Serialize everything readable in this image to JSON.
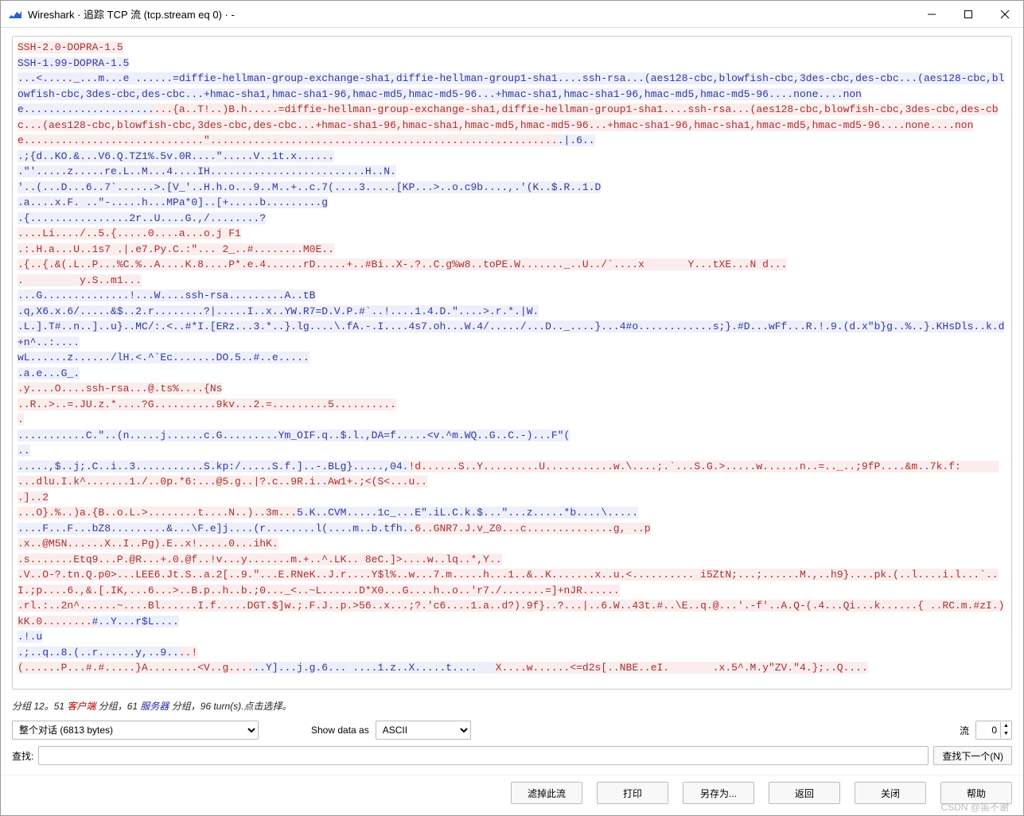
{
  "window": {
    "title": "Wireshark · 追踪 TCP 流 (tcp.stream eq 0) · -"
  },
  "stream": {
    "segments": [
      {
        "d": "c",
        "t": "SSH-2.0-DOPRA-1.5"
      },
      {
        "d": "br"
      },
      {
        "d": "s",
        "t": "SSH-1.99-DOPRA-1.5"
      },
      {
        "d": "br"
      },
      {
        "d": "s",
        "t": "...<....._...m...e ......=diffie-hellman-group-exchange-sha1,diffie-hellman-group1-sha1....ssh-rsa...(aes128-cbc,blowfish-cbc,3des-cbc,des-cbc...(aes128-cbc,blowfish-cbc,3des-cbc,des-cbc...+hmac-sha1,hmac-sha1-96,hmac-md5,hmac-md5-96...+hmac-sha1,hmac-sha1-96,hmac-md5,hmac-md5-96....none....none....................."
      },
      {
        "d": "c",
        "t": "...{a..T!..)B.h.....=diffie-hellman-group-exchange-sha1,diffie-hellman-group1-sha1....ssh-rsa...(aes128-cbc,blowfish-cbc,3des-cbc,des-cbc...(aes128-cbc,blowfish-cbc,3des-cbc,des-cbc...+hmac-sha1-96,hmac-sha1,hmac-md5,hmac-md5-96...+hmac-sha1-96,hmac-sha1,hmac-md5,hmac-md5-96....none....none.............................\"........................................................"
      },
      {
        "d": "s",
        "t": ".|.6.."
      },
      {
        "d": "br"
      },
      {
        "d": "s",
        "t": ".;{d..KO.&...V6.Q.TZ1%.5v.0R....\".....V..1t.x......"
      },
      {
        "d": "br"
      },
      {
        "d": "s",
        "t": ".\"'.....z.....re.L..M...4....IH.........................H..N."
      },
      {
        "d": "br"
      },
      {
        "d": "s",
        "t": "'..(...D...6..7`......>.[V_'..H.h.o...9..M..+..c.7(....3.....[KP...>..o.c9b....,.'(K..$.R..1.D"
      },
      {
        "d": "br"
      },
      {
        "d": "s",
        "t": ".a....x.F. ..\"-.....h...MPa*0]..[+.....b.........g"
      },
      {
        "d": "br"
      },
      {
        "d": "s",
        "t": ".{................2r..U....G.,/........?"
      },
      {
        "d": "br"
      },
      {
        "d": "c",
        "t": "....Li..../..5.{.....0....a...o.j F1"
      },
      {
        "d": "br"
      },
      {
        "d": "c",
        "t": ".:.H.a...U..1s7 .|.e7.Py.C.:\"... 2_..#........M0E.."
      },
      {
        "d": "br"
      },
      {
        "d": "c",
        "t": ".{..{.&(.L..P...%C.%..A....K.8....P*.e.4......rD.....+..#Bi..X-.?..C.g%w8..toPE.W......._..U../`....x       Y...tXE...N d..."
      },
      {
        "d": "br"
      },
      {
        "d": "c",
        "t": ".         y.S..m1..."
      },
      {
        "d": "br"
      },
      {
        "d": "s",
        "t": "...G..............!...W....ssh-rsa.........A..tB"
      },
      {
        "d": "br"
      },
      {
        "d": "s",
        "t": ".q,X6.x.6/.....&$..2.r........?|.....I..x..YW.R7=D.V.P.#`..!....1.4.D.\"....>.r.*.|W."
      },
      {
        "d": "br"
      },
      {
        "d": "s",
        "t": ".L.].T#..n..]..u}..MC/:.<..#*I.[ERz...3.*..}.lg....\\.fA.-.I....4s7.oh...W.4/...../...D.._....}...4#o............s;}.#D...wFf...R.!.9.(d.x\"b}g..%..}.KHsDls..k.d+n^..:...."
      },
      {
        "d": "br"
      },
      {
        "d": "s",
        "t": "wL......z....../lH.<.^`Ec.......DO.5..#..e....."
      },
      {
        "d": "br"
      },
      {
        "d": "s",
        "t": ".a.e...G_."
      },
      {
        "d": "br"
      },
      {
        "d": "c",
        "t": ".y....O....ssh-rsa...@.ts%....{Ns"
      },
      {
        "d": "br"
      },
      {
        "d": "c",
        "t": "..R..>..=.JU.z.*....?G..........9kv...2.=.........5.........."
      },
      {
        "d": "br"
      },
      {
        "d": "c",
        "t": "."
      },
      {
        "d": "br"
      },
      {
        "d": "s",
        "t": "...........C.\"..(n.....j......c.G.........Ym_OIF.q..$.l.,DA=f.....<v.^m.WQ..G..C.-)...F\"("
      },
      {
        "d": "br"
      },
      {
        "d": "s",
        "t": ".."
      },
      {
        "d": "br"
      },
      {
        "d": "s",
        "t": ".....,$..j;.C..i..3...........S.kp:/.....S.f.]..-.BLg}.....,04."
      },
      {
        "d": "c",
        "t": "!d......S..Y.........U...........w.\\....;.`...S.G.>.....w......n..=.._..;9fP....&m..7k.f:      ...dlu.I.k^.......1./..0p.*6:...@5.g..|?.c..9R.i..Aw1+.;<(S<...u.."
      },
      {
        "d": "br"
      },
      {
        "d": "c",
        "t": ".]..2"
      },
      {
        "d": "br"
      },
      {
        "d": "c",
        "t": "...O}.%..)a.{B..o.L.>........t....N..)..3m..."
      },
      {
        "d": "s",
        "t": "5.K..CVM.....1c_...E\".iL.C.k.$...\"...z.....*b....\\....."
      },
      {
        "d": "br"
      },
      {
        "d": "s",
        "t": "....F...F...bZ8.........&...\\F.e]j....(r........l(....m..b.tfh.."
      },
      {
        "d": "c",
        "t": "6..GNR7.J.v_Z0...c..............g, ..p"
      },
      {
        "d": "br"
      },
      {
        "d": "c",
        "t": ".x..@M5N......X..I..Pg).E..x!.....0...ihK."
      },
      {
        "d": "br"
      },
      {
        "d": "c",
        "t": ".s.......Etq9...P.@R...+.0.@f..!v...y.......m.+..^.LK.. 8eC.]>....w..lq..*,Y.."
      },
      {
        "d": "br"
      },
      {
        "d": "c",
        "t": ".V..O-?.tn.Q.p0>...LEE6.Jt.S..a.2[..9.\"...E.RNeK..J.r....Y$l%..w...7.m.....h...1..&..K.......x..u.<.......... i5ZtN;...;......M.,..h9}....pk.(..l....i.l...`..I.;p....6.,&.[.IK,...6...>..B.p..h..b.;0..._<..~L......D*X0...G....h..o..'r7./.......=]+nJR......"
      },
      {
        "d": "br"
      },
      {
        "d": "c",
        "t": ".rl.:..2n^......~....Bl......I.f.....DGT.$]w.;.F.J..p.>56..x...;?.'c6....1.a..d?).9f}..?...|..6.W..43t.#..\\E..q.@...'.-f'..A.Q-(.4...Qi...k......{ ..RC.m.#zI.)kK.0........"
      },
      {
        "d": "s",
        "t": "#..Y...r$L...."
      },
      {
        "d": "br"
      },
      {
        "d": "s",
        "t": ".!.u"
      },
      {
        "d": "br"
      },
      {
        "d": "s",
        "t": ".;..q..8.(..r......y,..9.."
      },
      {
        "d": "c",
        "t": "..!"
      },
      {
        "d": "br"
      },
      {
        "d": "c",
        "t": "(......P...#.#.....}A........<V..g...."
      },
      {
        "d": "s",
        "t": "..Y]...j.g.6... ....1.z..X.....t....   "
      },
      {
        "d": "c",
        "t": "X....w......<=d2s[..NBE..eI.       .x.5^.M.y\"ZV.\"4.};..Q...."
      }
    ]
  },
  "infobar": {
    "prefix": "分组 12。",
    "count1": "51 ",
    "role1": "客户端",
    "mid1": " 分组，",
    "count2": "61 ",
    "role2": "服务器",
    "mid2": " 分组，",
    "suffix": "96 turn(s).点击选择。"
  },
  "controls": {
    "conversation": "整个对话  (6813 bytes)",
    "show_data_as_label": "Show data as",
    "format": "ASCII",
    "stream_label": "流",
    "stream_value": "0",
    "find_label": "查找:",
    "find_next_button": "查找下一个(N)"
  },
  "buttons": {
    "filter_out": "滤掉此流",
    "print": "打印",
    "save_as": "另存为...",
    "back": "返回",
    "close": "关闭",
    "help": "帮助"
  },
  "watermark": "CSDN @笛不谢"
}
